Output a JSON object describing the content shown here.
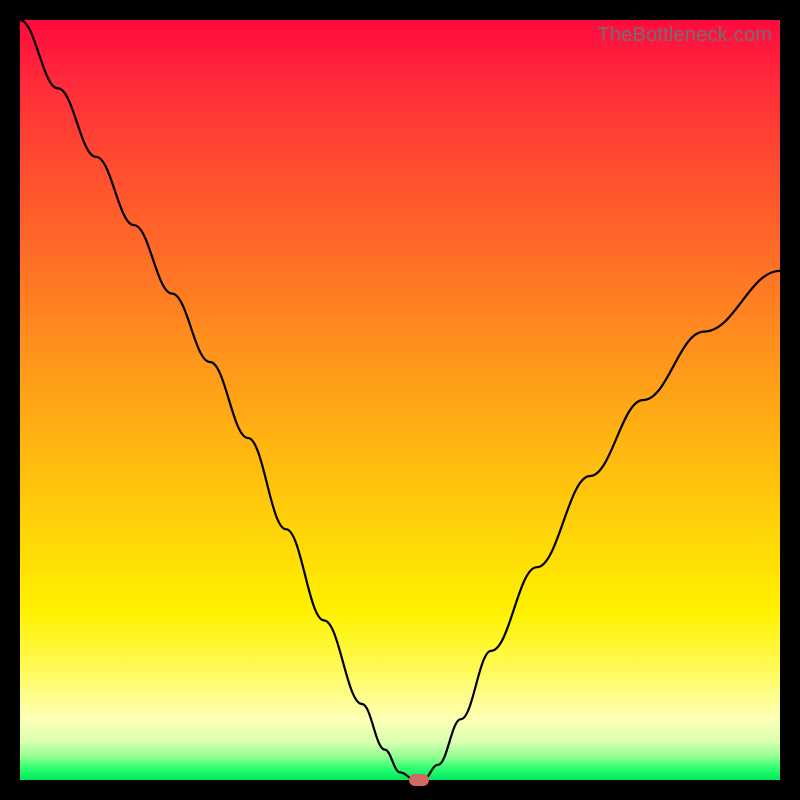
{
  "watermark": "TheBottleneck.com",
  "chart_data": {
    "type": "line",
    "title": "",
    "xlabel": "",
    "ylabel": "",
    "xlim": [
      0,
      100
    ],
    "ylim": [
      0,
      100
    ],
    "gradient_background": {
      "top_color": "#ff0a3f",
      "bottom_color": "#00e85f",
      "meaning": "bottleneck severity (red=high, green=low)"
    },
    "series": [
      {
        "name": "bottleneck-curve",
        "x": [
          0,
          5,
          10,
          15,
          20,
          25,
          30,
          35,
          40,
          45,
          48,
          50,
          52,
          53,
          55,
          58,
          62,
          68,
          75,
          82,
          90,
          100
        ],
        "values": [
          100,
          91,
          82,
          73,
          64,
          55,
          45,
          33,
          21,
          10,
          4,
          1,
          0,
          0,
          2,
          8,
          17,
          28,
          40,
          50,
          59,
          67
        ]
      }
    ],
    "annotations": [
      {
        "name": "optimal-point-marker",
        "x": 52.5,
        "y": 0,
        "color": "#d06a60"
      }
    ]
  }
}
